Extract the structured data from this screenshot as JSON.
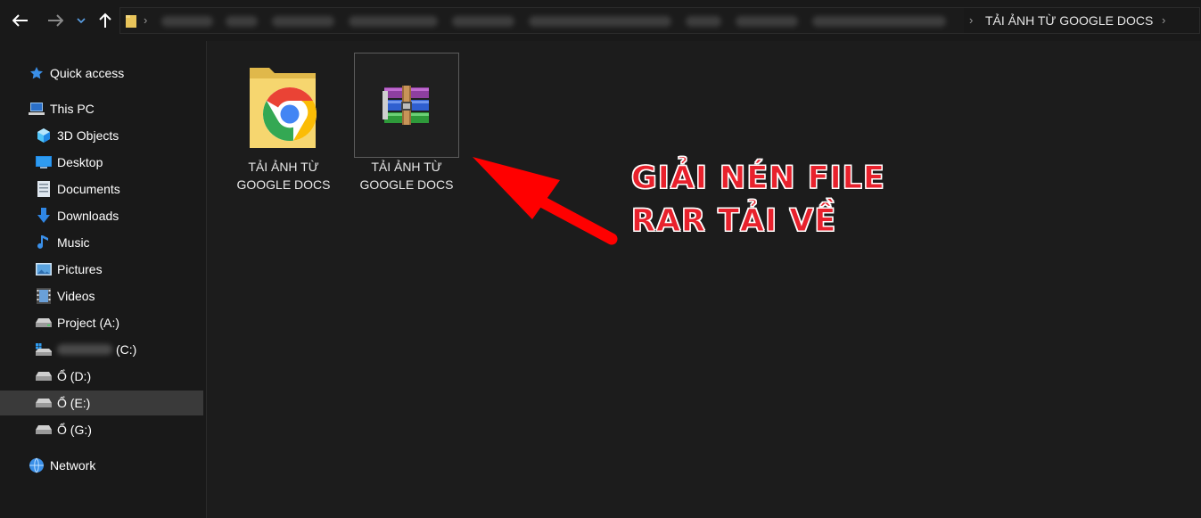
{
  "nav": {
    "back": "back-arrow",
    "forward": "forward-arrow",
    "recent": "chevron-down",
    "up": "up-arrow"
  },
  "address": {
    "current_folder": "TẢI ẢNH TỪ GOOGLE DOCS"
  },
  "sidebar": {
    "quick_access": "Quick access",
    "this_pc": "This PC",
    "items": [
      {
        "label": "3D Objects",
        "icon": "cube-icon"
      },
      {
        "label": "Desktop",
        "icon": "desktop-icon"
      },
      {
        "label": "Documents",
        "icon": "document-icon"
      },
      {
        "label": "Downloads",
        "icon": "download-icon"
      },
      {
        "label": "Music",
        "icon": "music-icon"
      },
      {
        "label": "Pictures",
        "icon": "picture-icon"
      },
      {
        "label": "Videos",
        "icon": "video-icon"
      },
      {
        "label": "Project (A:)",
        "icon": "drive-icon"
      },
      {
        "label": "(C:)",
        "icon": "windows-drive-icon"
      },
      {
        "label": "Ổ (D:)",
        "icon": "drive-icon"
      },
      {
        "label": "Ổ (E:)",
        "icon": "drive-icon"
      },
      {
        "label": "Ổ (G:)",
        "icon": "drive-icon"
      }
    ],
    "network": "Network"
  },
  "files": [
    {
      "line1": "TẢI ẢNH TỪ",
      "line2": "GOOGLE DOCS",
      "icon": "chrome-folder-icon"
    },
    {
      "line1": "TẢI ẢNH TỪ",
      "line2": "GOOGLE DOCS",
      "icon": "winrar-archive-icon"
    }
  ],
  "annotation": {
    "line1": "GIẢI NÉN FILE",
    "line2": "RAR TẢI VỀ",
    "color": "#e8212c"
  }
}
